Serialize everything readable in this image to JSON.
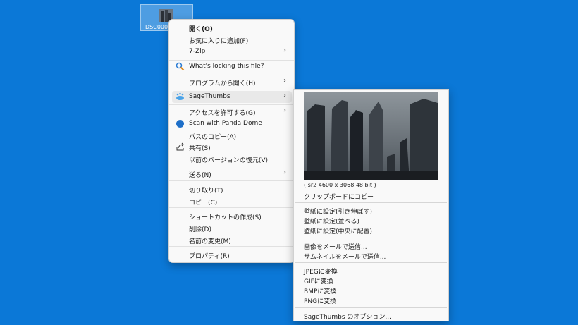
{
  "desktop": {
    "file_label": "DSC0000"
  },
  "menu": {
    "open": "開く(O)",
    "add_favorites": "お気に入りに追加(F)",
    "seven_zip": "7-Zip",
    "whats_locking": "What's locking this file?",
    "open_with": "プログラムから開く(H)",
    "sagethumbs": "SageThumbs",
    "grant_access": "アクセスを許可する(G)",
    "scan_panda": "Scan with Panda Dome",
    "copy_path": "パスのコピー(A)",
    "share": "共有(S)",
    "restore_prev": "以前のバージョンの復元(V)",
    "send_to": "送る(N)",
    "cut": "切り取り(T)",
    "copy": "コピー(C)",
    "create_shortcut": "ショートカットの作成(S)",
    "delete": "削除(D)",
    "rename": "名前の変更(M)",
    "properties": "プロパティ(R)"
  },
  "submenu": {
    "image_info": "( sr2 4600 x 3068 48 bit )",
    "copy_clipboard": "クリップボードにコピー",
    "wallpaper_stretch": "壁紙に設定(引き伸ばす)",
    "wallpaper_tile": "壁紙に設定(並べる)",
    "wallpaper_center": "壁紙に設定(中央に配置)",
    "email_image": "画像をメールで送信...",
    "email_thumbnail": "サムネイルをメールで送信...",
    "convert_jpeg": "JPEGに変換",
    "convert_gif": "GIFに変換",
    "convert_bmp": "BMPに変換",
    "convert_png": "PNGに変換",
    "options": "SageThumbs のオプション..."
  },
  "colors": {
    "desktop": "#0b78d7",
    "menu_bg": "#f9f9f9",
    "highlight": "#e9e9e9"
  }
}
